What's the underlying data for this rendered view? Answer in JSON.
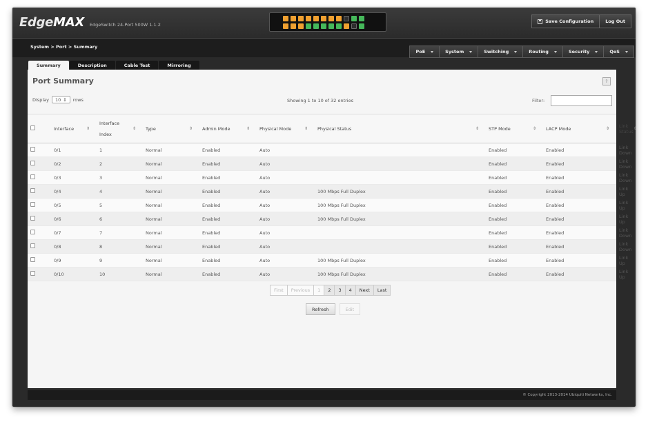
{
  "header": {
    "logo_main": "Edge",
    "logo_max": "MAX",
    "model": "EdgeSwitch 24-Port 500W 1.1.2",
    "save_label": "Save Configuration",
    "logout_label": "Log Out",
    "ports_top": [
      "orange",
      "orange",
      "orange",
      "orange",
      "orange",
      "orange",
      "orange",
      "orange",
      "down",
      "green",
      "green"
    ],
    "ports_bottom": [
      "orange",
      "orange",
      "orange",
      "green",
      "green",
      "green",
      "green",
      "green",
      "orange",
      "down",
      "green"
    ]
  },
  "nav": {
    "breadcrumb": "System > Port > Summary",
    "menus": [
      "PoE",
      "System",
      "Switching",
      "Routing",
      "Security",
      "QoS"
    ]
  },
  "tabs": [
    "Summary",
    "Description",
    "Cable Test",
    "Mirroring"
  ],
  "page": {
    "title": "Port Summary",
    "help": "?",
    "display_label": "Display",
    "display_value": "10",
    "rows_label": "rows",
    "showing": "Showing 1 to 10 of 32 entries",
    "filter_label": "Filter:"
  },
  "table": {
    "columns": [
      "Interface",
      "Interface Index",
      "Type",
      "Admin Mode",
      "Physical Mode",
      "Physical Status",
      "STP Mode",
      "LACP Mode",
      "Link Status"
    ],
    "rows": [
      [
        "0/1",
        "1",
        "Normal",
        "Enabled",
        "Auto",
        "",
        "Enabled",
        "Enabled",
        "Link Down"
      ],
      [
        "0/2",
        "2",
        "Normal",
        "Enabled",
        "Auto",
        "",
        "Enabled",
        "Enabled",
        "Link Down"
      ],
      [
        "0/3",
        "3",
        "Normal",
        "Enabled",
        "Auto",
        "",
        "Enabled",
        "Enabled",
        "Link Down"
      ],
      [
        "0/4",
        "4",
        "Normal",
        "Enabled",
        "Auto",
        "100 Mbps Full Duplex",
        "Enabled",
        "Enabled",
        "Link Up"
      ],
      [
        "0/5",
        "5",
        "Normal",
        "Enabled",
        "Auto",
        "100 Mbps Full Duplex",
        "Enabled",
        "Enabled",
        "Link Up"
      ],
      [
        "0/6",
        "6",
        "Normal",
        "Enabled",
        "Auto",
        "100 Mbps Full Duplex",
        "Enabled",
        "Enabled",
        "Link Up"
      ],
      [
        "0/7",
        "7",
        "Normal",
        "Enabled",
        "Auto",
        "",
        "Enabled",
        "Enabled",
        "Link Down"
      ],
      [
        "0/8",
        "8",
        "Normal",
        "Enabled",
        "Auto",
        "",
        "Enabled",
        "Enabled",
        "Link Down"
      ],
      [
        "0/9",
        "9",
        "Normal",
        "Enabled",
        "Auto",
        "100 Mbps Full Duplex",
        "Enabled",
        "Enabled",
        "Link Up"
      ],
      [
        "0/10",
        "10",
        "Normal",
        "Enabled",
        "Auto",
        "100 Mbps Full Duplex",
        "Enabled",
        "Enabled",
        "Link Up"
      ]
    ]
  },
  "pager": {
    "first": "First",
    "previous": "Previous",
    "pages": [
      "1",
      "2",
      "3",
      "4"
    ],
    "next": "Next",
    "last": "Last"
  },
  "actions": {
    "refresh": "Refresh",
    "edit": "Edit"
  },
  "footer": {
    "copyright": "© Copyright 2013-2014 Ubiquiti Networks, Inc."
  }
}
